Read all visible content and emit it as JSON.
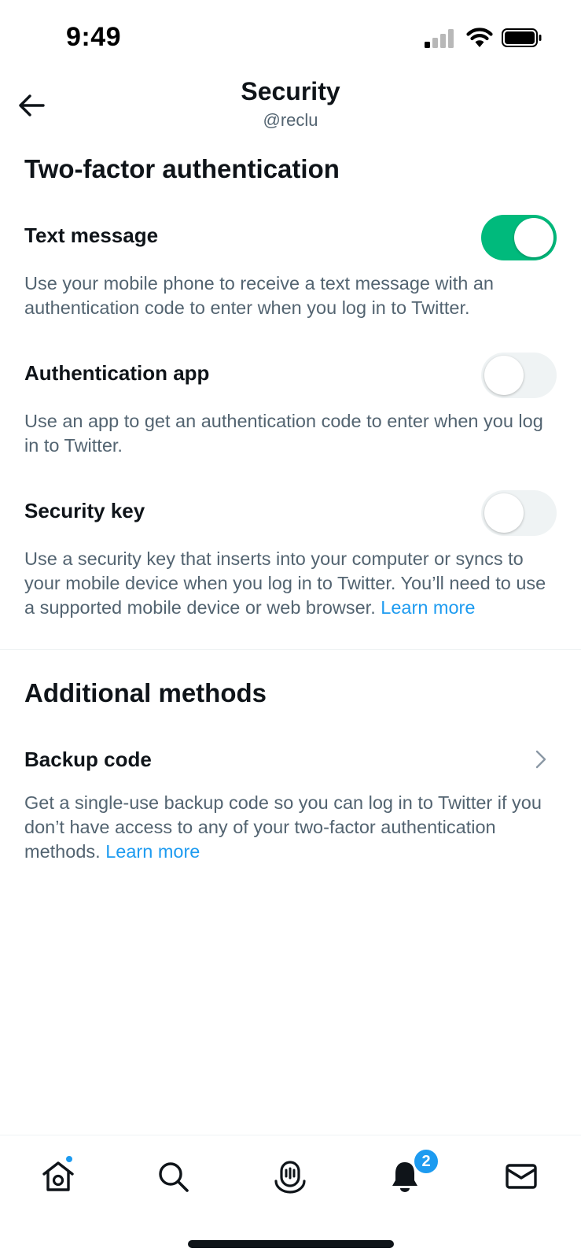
{
  "status_bar": {
    "time": "9:49"
  },
  "header": {
    "title": "Security",
    "username": "@reclu"
  },
  "two_factor": {
    "heading": "Two-factor authentication",
    "items": [
      {
        "title": "Text message",
        "description": "Use your mobile phone to receive a text message with an authentication code to enter when you log in to Twitter.",
        "enabled": true
      },
      {
        "title": "Authentication app",
        "description": "Use an app to get an authentication code to enter when you log in to Twitter.",
        "enabled": false
      },
      {
        "title": "Security key",
        "description": "Use a security key that inserts into your computer or syncs to your mobile device when you log in to Twitter. You’ll need to use a supported mobile device or web browser.",
        "link": "Learn more",
        "enabled": false
      }
    ]
  },
  "additional": {
    "heading": "Additional methods",
    "backup": {
      "title": "Backup code",
      "description": "Get a single-use backup code so you can log in to Twitter if you don’t have access to any of your two-factor authentication methods.",
      "link": "Learn more"
    }
  },
  "tab_bar": {
    "items": [
      {
        "name": "home",
        "icon": "home-icon",
        "has_dot": true
      },
      {
        "name": "search",
        "icon": "search-icon"
      },
      {
        "name": "spaces",
        "icon": "spaces-icon"
      },
      {
        "name": "notifications",
        "icon": "bell-icon",
        "badge": "2"
      },
      {
        "name": "messages",
        "icon": "mail-icon"
      }
    ]
  },
  "colors": {
    "accent": "#1d9bf0",
    "toggle_on": "#00ba7c",
    "toggle_off": "#eff3f4",
    "secondary_text": "#536471"
  }
}
